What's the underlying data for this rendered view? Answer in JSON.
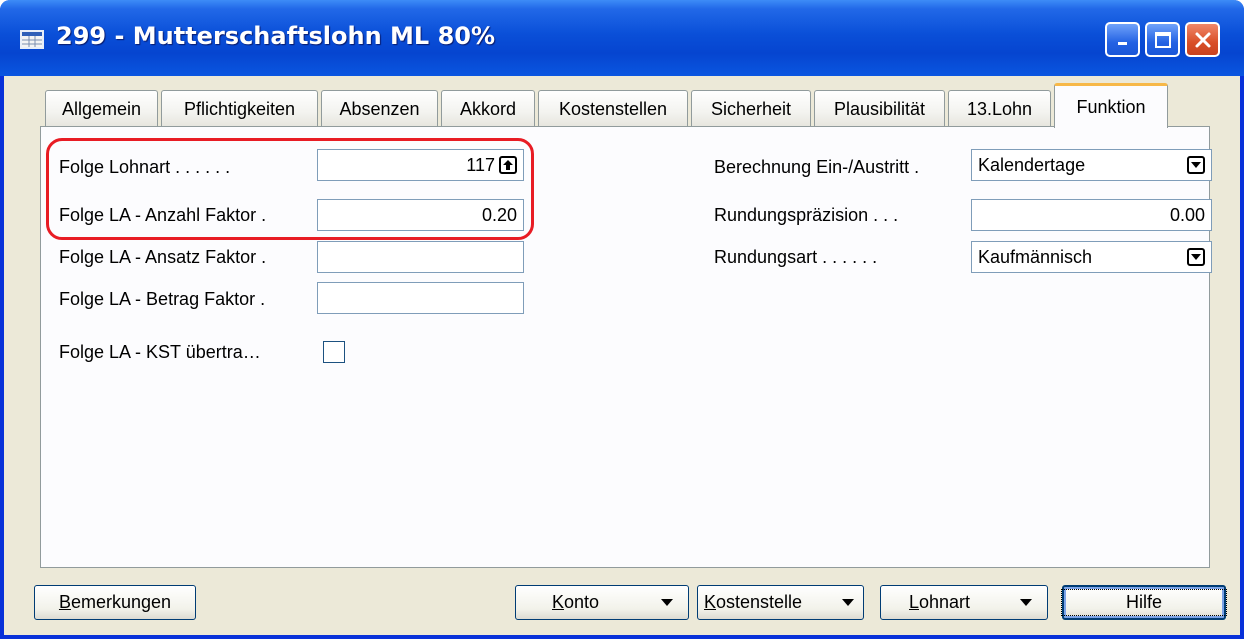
{
  "window": {
    "title": "299 - Mutterschaftslohn ML 80%",
    "icons": {
      "app": "table-icon",
      "minimize": "minimize-icon",
      "maximize": "maximize-icon",
      "close": "close-icon"
    },
    "colors": {
      "titlebar": "#0a4fd8",
      "close": "#d94f27",
      "highlight": "#e81c24",
      "active_tab_accent": "#f7b848"
    }
  },
  "tabs": [
    {
      "label": "Allgemein"
    },
    {
      "label": "Pflichtigkeiten"
    },
    {
      "label": "Absenzen"
    },
    {
      "label": "Akkord"
    },
    {
      "label": "Kostenstellen"
    },
    {
      "label": "Sicherheit"
    },
    {
      "label": "Plausibilität"
    },
    {
      "label": "13.Lohn"
    },
    {
      "label": "Funktion",
      "active": true
    }
  ],
  "left_fields": {
    "folge_lohnart": {
      "label": "Folge Lohnart . . . . . .",
      "value": "117",
      "button_icon": "lookup-arrow-up-icon"
    },
    "anzahl_faktor": {
      "label": "Folge LA - Anzahl Faktor .",
      "value": "0.20"
    },
    "ansatz_faktor": {
      "label": "Folge LA - Ansatz Faktor .",
      "value": ""
    },
    "betrag_faktor": {
      "label": "Folge LA - Betrag Faktor .",
      "value": ""
    },
    "kst_uebertragen": {
      "label": "Folge LA - KST übertra…",
      "checked": false
    }
  },
  "right_fields": {
    "berechnung": {
      "label": "Berechnung Ein-/Austritt .",
      "value": "Kalendertage",
      "button_icon": "dropdown-arrow-icon"
    },
    "rundungspraezision": {
      "label": "Rundungspräzision . . .",
      "value": "0.00"
    },
    "rundungsart": {
      "label": "Rundungsart . . . . . .",
      "value": "Kaufmännisch",
      "button_icon": "dropdown-arrow-icon"
    }
  },
  "buttons": {
    "bemerkungen": {
      "mnemonic": "B",
      "rest": "emerkungen"
    },
    "konto": {
      "mnemonic": "K",
      "rest": "onto"
    },
    "kostenstelle": {
      "mnemonic": "K",
      "rest": "ostenstelle"
    },
    "lohnart": {
      "mnemonic": "L",
      "rest": "ohnart"
    },
    "hilfe": {
      "label": "Hilfe"
    }
  }
}
